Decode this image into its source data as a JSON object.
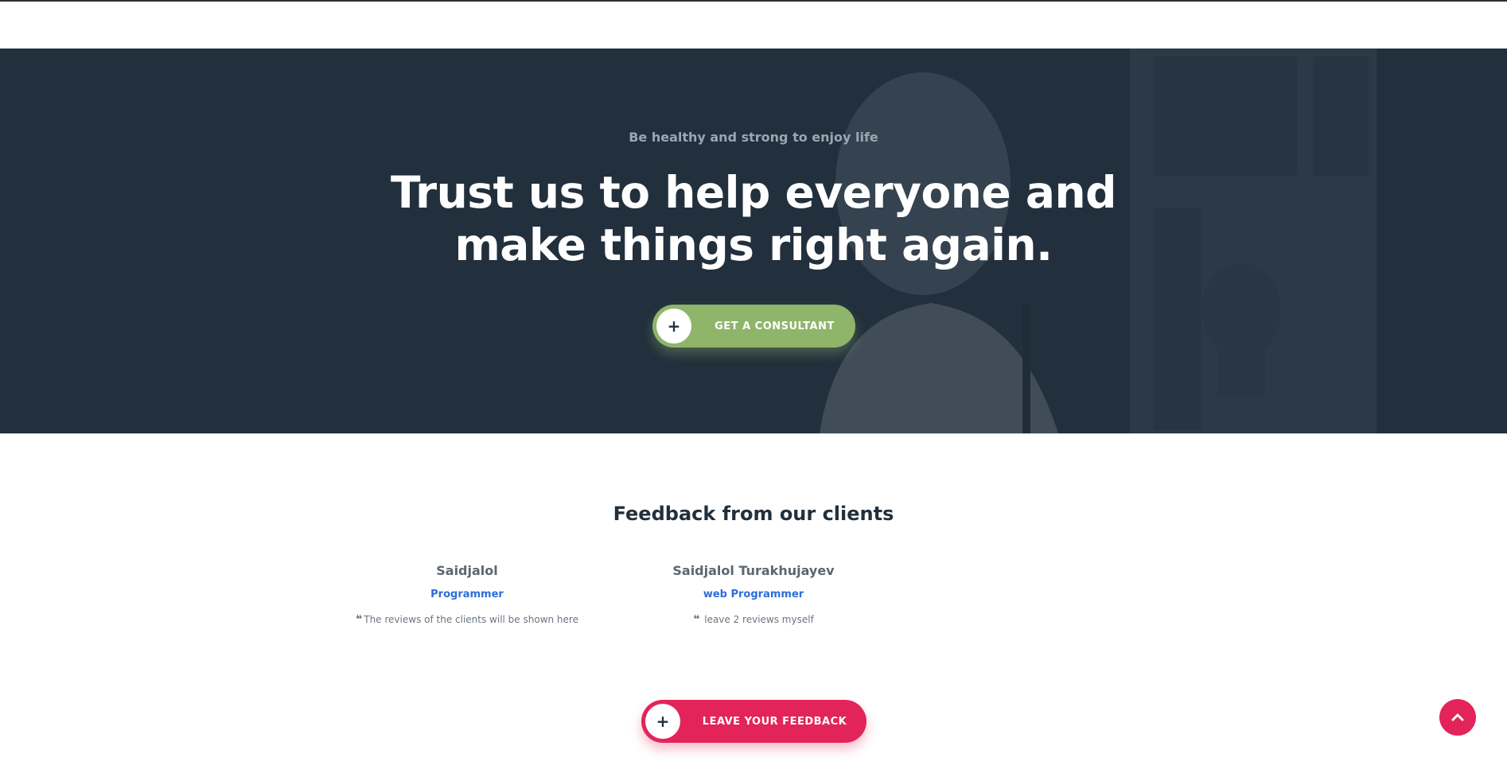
{
  "hero": {
    "tagline": "Be healthy and strong to enjoy life",
    "title_line1": "Trust us to help everyone and",
    "title_line2": "make things right again.",
    "cta_label": "GET A CONSULTANT",
    "cta_icon": "plus-icon",
    "background_color": "#22303d",
    "cta_color": "#8fb56a"
  },
  "feedback": {
    "title": "Feedback from our clients",
    "reviews": [
      {
        "name": "Saidjalol",
        "role": "Programmer",
        "text": "The reviews of the clients will be shown here"
      },
      {
        "name": "Saidjalol Turakhujayev",
        "role": "web Programmer",
        "text": " leave 2 reviews myself"
      }
    ],
    "quote_icon": "quote-left-icon",
    "cta_label": "LEAVE YOUR FEEDBACK",
    "cta_icon": "plus-icon",
    "cta_color": "#e3245a"
  },
  "scroll_top": {
    "icon": "chevron-up-icon",
    "color": "#e3245a"
  }
}
